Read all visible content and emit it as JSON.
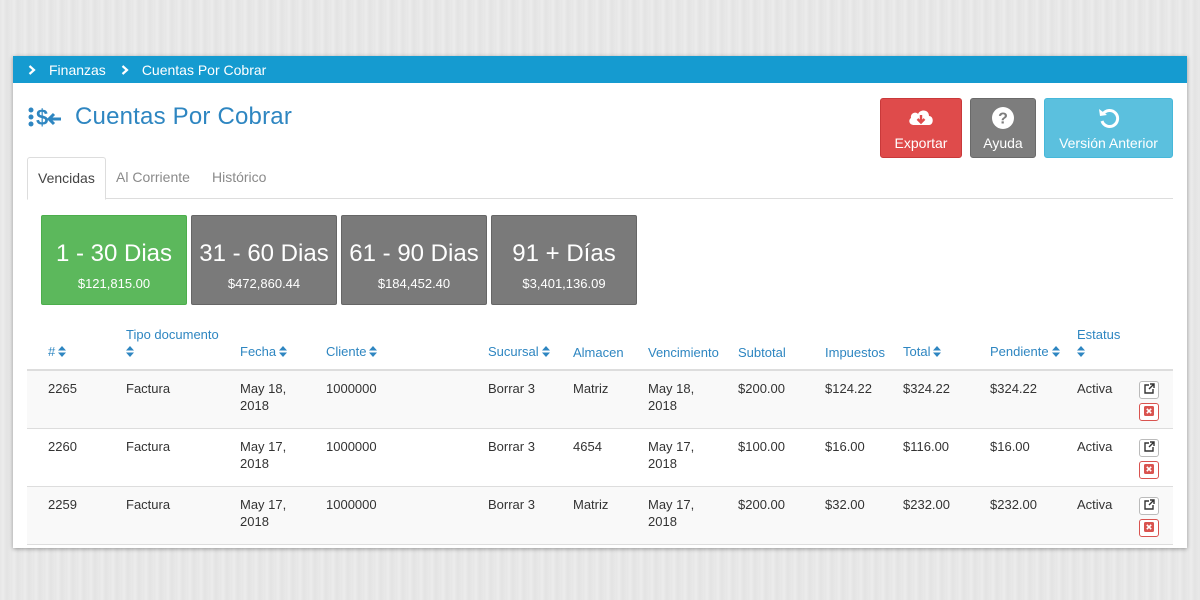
{
  "breadcrumb": [
    "Finanzas",
    "Cuentas Por Cobrar"
  ],
  "page_title": "Cuentas Por Cobrar",
  "buttons": {
    "export": "Exportar",
    "help": "Ayuda",
    "previous_version": "Versión Anterior"
  },
  "tabs": [
    {
      "label": "Vencidas",
      "active": true
    },
    {
      "label": "Al Corriente",
      "active": false
    },
    {
      "label": "Histórico",
      "active": false
    }
  ],
  "aging_cards": [
    {
      "range": "1 - 30 Dias",
      "amount": "$121,815.00",
      "color": "#5cb85c"
    },
    {
      "range": "31 - 60 Dias",
      "amount": "$472,860.44",
      "color": "#7a7a7a"
    },
    {
      "range": "61 - 90 Dias",
      "amount": "$184,452.40",
      "color": "#7a7a7a"
    },
    {
      "range": "91 + Días",
      "amount": "$3,401,136.09",
      "color": "#7a7a7a"
    }
  ],
  "table": {
    "columns": [
      "#",
      "Tipo documento",
      "Fecha",
      "Cliente",
      "Sucursal",
      "Almacen",
      "Vencimiento",
      "Subtotal",
      "Impuestos",
      "Total",
      "Pendiente",
      "Estatus"
    ],
    "rows": [
      [
        "2265",
        "Factura",
        "May 18, 2018",
        "1000000",
        "Borrar 3",
        "Matriz",
        "May 18, 2018",
        "$200.00",
        "$124.22",
        "$324.22",
        "$324.22",
        "Activa"
      ],
      [
        "2260",
        "Factura",
        "May 17, 2018",
        "1000000",
        "Borrar 3",
        "4654",
        "May 17, 2018",
        "$100.00",
        "$16.00",
        "$116.00",
        "$16.00",
        "Activa"
      ],
      [
        "2259",
        "Factura",
        "May 17, 2018",
        "1000000",
        "Borrar 3",
        "Matriz",
        "May 17, 2018",
        "$200.00",
        "$32.00",
        "$232.00",
        "$232.00",
        "Activa"
      ]
    ]
  },
  "colors": {
    "topbar": "#159bd0",
    "title": "#2e86c1",
    "export": "#df4b4b",
    "help": "#7d7d7d",
    "previous_version": "#5bc0de"
  },
  "icons": {
    "breadcrumb_separator": "chevron-right-icon",
    "title": "money-transfer-icon",
    "export": "cloud-download-icon",
    "help": "question-circle-icon",
    "previous_version": "undo-icon",
    "sort": "sort-icon",
    "open": "external-link-icon",
    "delete": "close-icon"
  }
}
